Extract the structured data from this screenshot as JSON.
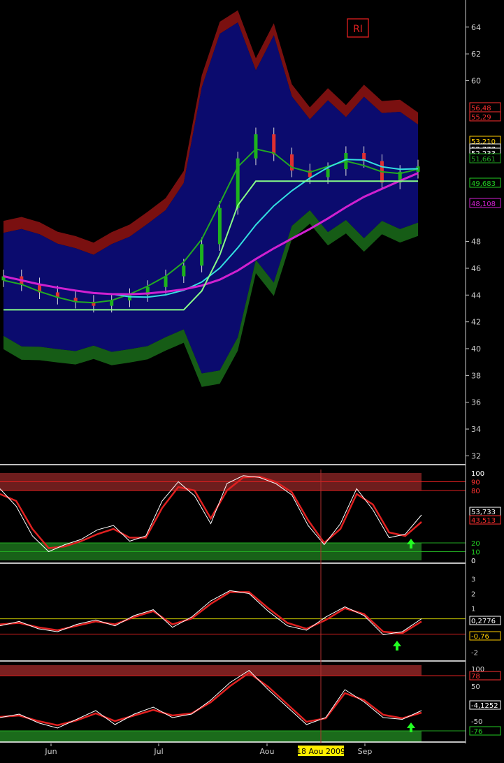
{
  "symbol": "RI",
  "colors": {
    "background": "#000000",
    "band_fill": "#0b0b6e",
    "upper_band": "#7a1010",
    "lower_band": "#165c16",
    "up_candle": "#1db31d",
    "down_candle": "#e03030",
    "ma_fast": "#ffffff",
    "ma_cyan": "#33e0e0",
    "ma_magenta": "#d020d0",
    "ma_green": "#22aa22",
    "stop_line": "#88ff88",
    "resistance": "#ff4040",
    "oscillator_line": "#ffffff",
    "signal_line": "#e02020",
    "cursor_line": "#b03030",
    "arrow": "#22ff22",
    "date_highlight": "#ffee00"
  },
  "chart_data": [
    {
      "type": "line",
      "panel": "price",
      "series": [
        {
          "values": [
            45.4,
            44.8,
            44.2,
            43.8,
            43.5,
            43.2,
            43.6,
            44.0,
            44.6,
            45.4,
            46.2,
            47.8,
            50.5,
            54.2,
            56.0,
            54.5,
            53.3,
            52.8,
            53.4,
            54.6,
            54.0,
            52.4,
            53.2,
            53.6
          ]
        }
      ],
      "x_labels": [
        "Jun",
        "Jul",
        "Aou",
        "Sep"
      ],
      "yticks": [
        32,
        34,
        36,
        38,
        40,
        42,
        44,
        46,
        48,
        60,
        62,
        64
      ],
      "ylim": [
        31.5,
        65.5
      ],
      "price_labels": [
        {
          "text": "56,48",
          "color": "#ff3030"
        },
        {
          "text": "55,29",
          "color": "#ff3030"
        },
        {
          "text": "53,210",
          "color": "#ffcc00"
        },
        {
          "text": "52,777",
          "color": "#ffffff"
        },
        {
          "text": "52,233",
          "color": "#ffffff"
        },
        {
          "text": "51,661",
          "color": "#22aa22"
        },
        {
          "text": "49,683",
          "color": "#22cc22"
        },
        {
          "text": "48,108",
          "color": "#d020d0"
        }
      ]
    },
    {
      "type": "line",
      "panel": "stochastic",
      "series": [
        {
          "values": [
            82,
            62,
            28,
            10,
            18,
            24,
            35,
            40,
            22,
            28,
            68,
            90,
            74,
            42,
            88,
            97,
            95,
            88,
            75,
            40,
            18,
            42,
            82,
            58,
            26,
            30,
            52
          ]
        },
        {
          "values": [
            76,
            68,
            36,
            14,
            16,
            22,
            30,
            36,
            26,
            26,
            60,
            84,
            80,
            48,
            80,
            95,
            96,
            90,
            78,
            46,
            20,
            36,
            76,
            64,
            32,
            28,
            44
          ]
        }
      ],
      "bands": [
        "100",
        "90",
        "80",
        "20",
        "10",
        "0"
      ],
      "labels": [
        {
          "text": "53,733",
          "color": "#ffffff"
        },
        {
          "text": "43,513",
          "color": "#ff3030"
        }
      ]
    },
    {
      "type": "line",
      "panel": "momentum",
      "series": [
        {
          "values": [
            -0.2,
            0.1,
            -0.4,
            -0.6,
            -0.1,
            0.2,
            -0.2,
            0.5,
            0.9,
            -0.3,
            0.4,
            1.5,
            2.2,
            2.0,
            0.8,
            -0.2,
            -0.5,
            0.4,
            1.1,
            0.5,
            -0.8,
            -0.6,
            0.28
          ]
        },
        {
          "values": [
            -0.1,
            0.0,
            -0.3,
            -0.5,
            -0.2,
            0.1,
            -0.1,
            0.4,
            0.8,
            -0.1,
            0.3,
            1.3,
            2.1,
            2.1,
            1.0,
            0.0,
            -0.4,
            0.2,
            1.0,
            0.6,
            -0.6,
            -0.7,
            0.1
          ]
        }
      ],
      "yticks": [
        "3",
        "2",
        "1",
        "-1",
        "-2"
      ],
      "ylim": [
        -2.5,
        3.5
      ],
      "labels": [
        {
          "text": "0,2776",
          "color": "#ffffff"
        },
        {
          "text": "-0,76",
          "color": "#ffcc00"
        }
      ]
    },
    {
      "type": "line",
      "panel": "williams",
      "series": [
        {
          "values": [
            -40,
            -30,
            -55,
            -70,
            -45,
            -20,
            -60,
            -30,
            -10,
            -40,
            -30,
            10,
            60,
            95,
            40,
            -10,
            -60,
            -40,
            40,
            5,
            -40,
            -45,
            -20
          ]
        },
        {
          "values": [
            -38,
            -34,
            -50,
            -62,
            -48,
            -28,
            -50,
            -34,
            -18,
            -34,
            -28,
            4,
            50,
            88,
            48,
            -2,
            -52,
            -42,
            30,
            10,
            -32,
            -42,
            -26
          ]
        }
      ],
      "yticks": [
        "100",
        "50",
        "-50"
      ],
      "ylim": [
        -110,
        110
      ],
      "labels": [
        {
          "text": "78",
          "color": "#ff3030"
        },
        {
          "text": "-4,1252",
          "color": "#ffffff"
        },
        {
          "text": "-76",
          "color": "#22cc22"
        }
      ]
    }
  ],
  "date_axis": {
    "cursor_label": "18 Aou 2009"
  }
}
